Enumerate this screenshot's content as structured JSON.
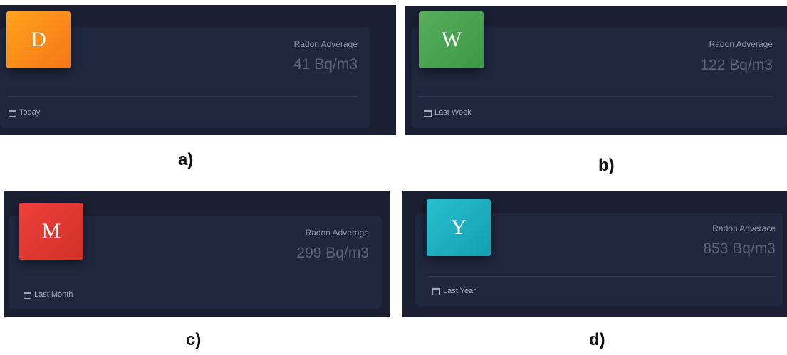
{
  "panels": [
    {
      "letter": "D",
      "color_from": "#ffa31a",
      "color_to": "#f6761a",
      "label": "Radon Adverage",
      "value": "41 Bq/m3",
      "period": "Today",
      "caption": "a)"
    },
    {
      "letter": "W",
      "color_from": "#58ad5c",
      "color_to": "#3c9946",
      "label": "Radon Adverage",
      "value": "122 Bq/m3",
      "period": "Last Week",
      "caption": "b)"
    },
    {
      "letter": "M",
      "color_from": "#ee4139",
      "color_to": "#d22f2a",
      "label": "Radon Adverage",
      "value": "299 Bq/m3",
      "period": "Last Month",
      "caption": "c)"
    },
    {
      "letter": "Y",
      "color_from": "#27c0cf",
      "color_to": "#139fb2",
      "label": "Radon Adverace",
      "value": "853 Bq/m3",
      "period": "Last Year",
      "caption": "d)"
    }
  ]
}
